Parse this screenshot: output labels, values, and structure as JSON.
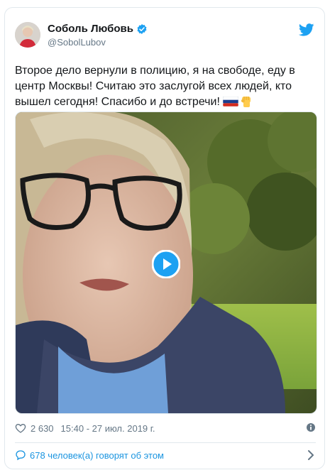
{
  "tweet": {
    "author_name": "Соболь Любовь",
    "author_handle": "@SobolLubov",
    "text": "Второе дело вернули в полицию, я на свободе, еду в центр Москвы! Считаю это заслугой всех людей, кто вышел сегодня! Спасибо и до встречи!",
    "emojis": [
      "russian-flag-icon",
      "raised-fist-icon"
    ],
    "likes": "2 630",
    "timestamp": "15:40 - 27 июл. 2019 г.",
    "footer_link": "678 человек(а) говорят об этом"
  },
  "colors": {
    "link_blue": "#1b95e0",
    "twitter_blue": "#1da1f2",
    "secondary_text": "#657786",
    "border": "#e1e8ed"
  }
}
